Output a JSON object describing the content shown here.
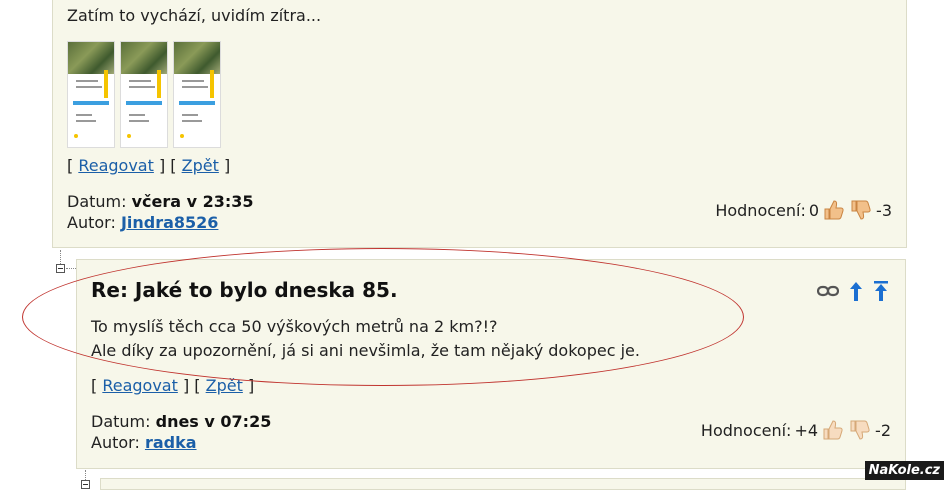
{
  "post1": {
    "text": "Zatím to vychází, uvidím zítra...",
    "links": {
      "reply": "Reagovat",
      "back": "Zpět"
    },
    "date_label": "Datum:",
    "date_value": "včera v 23:35",
    "author_label": "Autor:",
    "author": "Jindra8526",
    "rating_label": "Hodnocení:",
    "rating_plus": "0",
    "rating_minus": "-3"
  },
  "post2": {
    "title": "Re: Jaké to bylo dneska 85.",
    "line1": "To myslíš těch cca 50 výškových metrů na 2 km?!?",
    "line2": "Ale díky za upozornění, já si ani nevšimla, že tam nějaký dokopec je.",
    "links": {
      "reply": "Reagovat",
      "back": "Zpět"
    },
    "date_label": "Datum:",
    "date_value": "dnes v 07:25",
    "author_label": "Autor:",
    "author": "radka",
    "rating_label": "Hodnocení:",
    "rating_plus": "+4",
    "rating_minus": "-2"
  },
  "watermark": "NaKole.cz",
  "colors": {
    "link": "#1b5fa8",
    "post_bg": "#f7f7ea",
    "annotation": "#c0342f",
    "arrow": "#1b6fd1"
  }
}
